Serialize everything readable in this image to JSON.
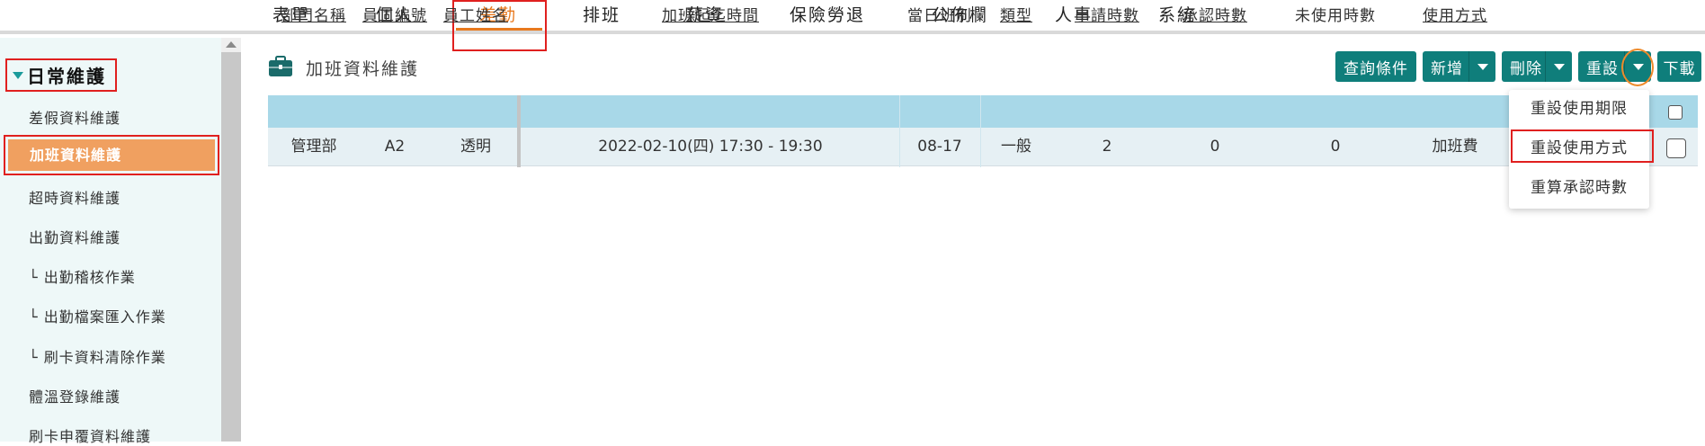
{
  "nav": {
    "items": [
      "表單",
      "個人",
      "差勤",
      "排班",
      "薪資",
      "保險勞退",
      "公佈欄",
      "人事",
      "系統"
    ],
    "active_index": 2
  },
  "sidebar": {
    "group_label": "日常維護",
    "items": [
      "差假資料維護",
      "加班資料維護",
      "超時資料維護",
      "出勤資料維護",
      "└ 出勤稽核作業",
      "└ 出勤檔案匯入作業",
      "└ 刷卡資料清除作業",
      "體溫登錄維護",
      "刷卡申覆資料維護"
    ],
    "active_index": 1
  },
  "page": {
    "title": "加班資料維護",
    "icon": "briefcase-icon"
  },
  "toolbar": {
    "query": "查詢條件",
    "add": "新增",
    "delete": "刪除",
    "reset": "重設",
    "download": "下載"
  },
  "table": {
    "headers": [
      "部門名稱",
      "員工編號",
      "員工姓名",
      "加班起迄時間",
      "當日班別",
      "類型",
      "申請時數",
      "承認時數",
      "未使用時數",
      "使用方式"
    ],
    "rows": [
      [
        "管理部",
        "A2",
        "透明",
        "2022-02-10(四) 17:30 - 19:30",
        "08-17",
        "一般",
        "2",
        "0",
        "0",
        "加班費"
      ]
    ]
  },
  "reset_menu": {
    "items": [
      "重設使用期限",
      "重設使用方式",
      "重算承認時數"
    ],
    "highlighted_index": 1
  },
  "colors": {
    "accent": "#0f7e7b",
    "nav_active": "#e8791e",
    "sidebar_active": "#f0a060",
    "table_header": "#a8d8e8",
    "highlight_red": "#e0201f"
  }
}
